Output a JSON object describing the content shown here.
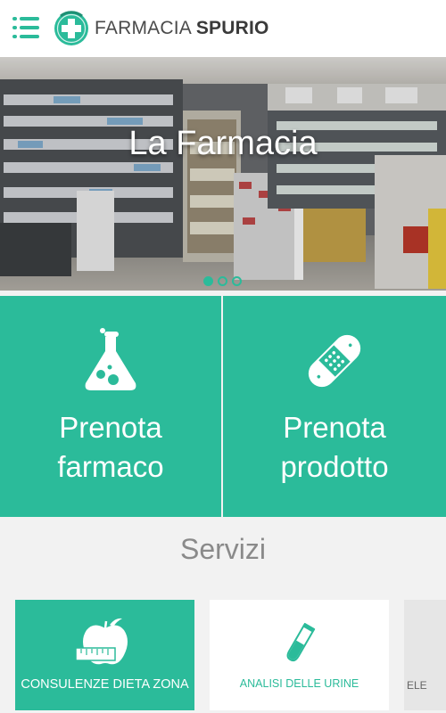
{
  "header": {
    "brand_prefix": "FARMACIA",
    "brand_name": "SPURIO"
  },
  "hero": {
    "title": "La Farmacia",
    "slides": 3,
    "active_slide": 1
  },
  "actions": [
    {
      "line1": "Prenota",
      "line2": "farmaco",
      "icon": "flask-icon"
    },
    {
      "line1": "Prenota",
      "line2": "prodotto",
      "icon": "bandage-icon"
    }
  ],
  "services": {
    "title": "Servizi",
    "items": [
      {
        "label": "CONSULENZE DIETA ZONA",
        "icon": "apple-tape-measure-icon"
      },
      {
        "label": "ANALISI DELLE URINE",
        "icon": "test-tube-icon"
      },
      {
        "label": "ELE",
        "icon": ""
      }
    ]
  },
  "colors": {
    "accent": "#2bbb9a",
    "header_bg": "#ffffff",
    "page_bg": "#f2f2f2",
    "muted_text": "#8a8a8a"
  }
}
